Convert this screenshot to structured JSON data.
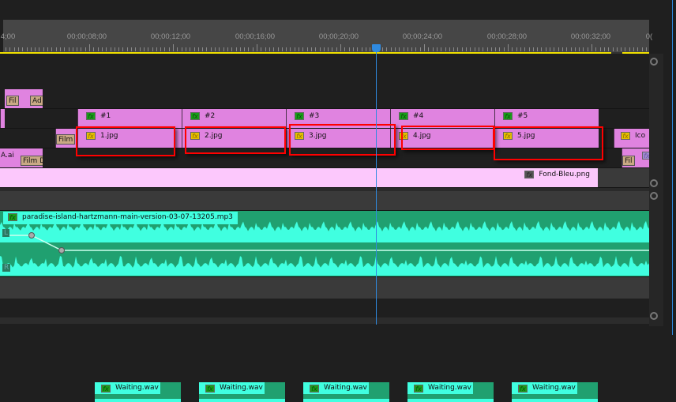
{
  "ruler": {
    "timecodes": [
      "4;00",
      "00;00;08;00",
      "00;00;12;00",
      "00;00;16;00",
      "00;00;20;00",
      "00;00;24;00",
      "00;00;28;00",
      "00;00;32;00",
      "0("
    ],
    "playhead_time": "00;00;22;12"
  },
  "tracks": {
    "v_top": {
      "tags": [
        "Fil",
        "Ad"
      ]
    },
    "nests": [
      {
        "label": "#1"
      },
      {
        "label": "#2"
      },
      {
        "label": "#3"
      },
      {
        "label": "#4"
      },
      {
        "label": "#5"
      }
    ],
    "images": [
      {
        "label": "1.jpg"
      },
      {
        "label": "2.jpg"
      },
      {
        "label": "3.jpg"
      },
      {
        "label": "4.jpg"
      },
      {
        "label": "5.jpg"
      }
    ],
    "film_tag": "Film",
    "ico_label": "Ico",
    "ai_label": "A.ai",
    "film_d_tag": "Film D",
    "fil_tag": "Fil",
    "background": "Fond-Bleu.png",
    "waiting": [
      "Waiting.wav",
      "Waiting.wav",
      "Waiting.wav",
      "Waiting.wav",
      "Waiting.wav"
    ],
    "music": "paradise-island-hartzmann-main-version-03-07-13205.mp3",
    "channel_l": "L",
    "channel_r": "R"
  },
  "icons": {
    "fx": "fx-badge-icon"
  },
  "colors": {
    "video_clip": "#e083e0",
    "audio_clip": "#20a070",
    "waveform": "#40ffe0",
    "playhead": "#2f8ae0",
    "work_area": "#f0e000",
    "highlight": "#ff0000"
  }
}
